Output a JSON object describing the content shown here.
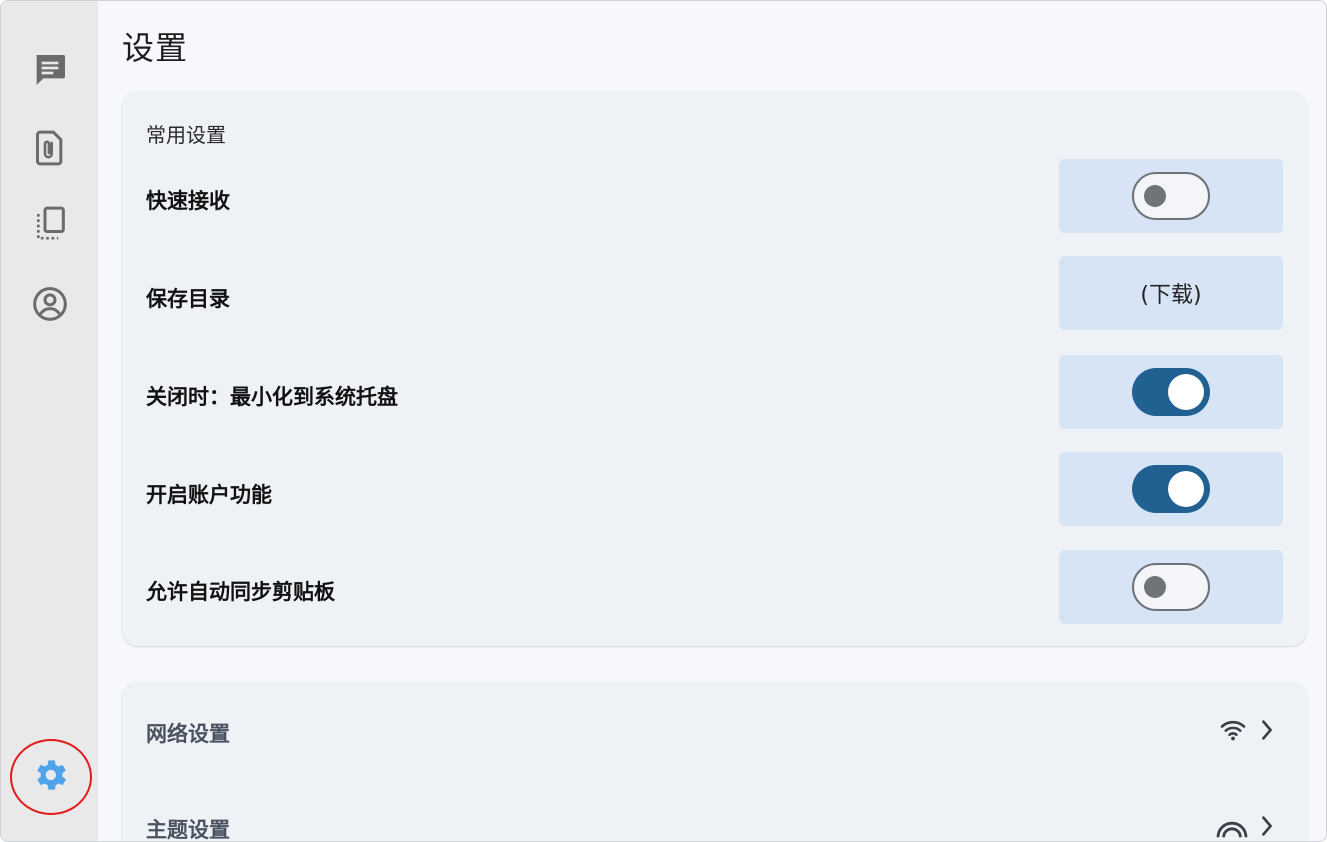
{
  "sidebar": {
    "items": [
      {
        "icon": "message-icon",
        "active": false
      },
      {
        "icon": "file-attachment-icon",
        "active": false
      },
      {
        "icon": "clipboard-history-icon",
        "active": false
      },
      {
        "icon": "account-icon",
        "active": false
      },
      {
        "icon": "settings-gear-icon",
        "active": true
      }
    ]
  },
  "page": {
    "title": "设置"
  },
  "general": {
    "section_title": "常用设置",
    "rows": [
      {
        "label": "快速接收",
        "control": "toggle",
        "on": false
      },
      {
        "label": "保存目录",
        "control": "value",
        "value": "(下载)"
      },
      {
        "label": "关闭时：最小化到系统托盘",
        "control": "toggle",
        "on": true
      },
      {
        "label": "开启账户功能",
        "control": "toggle",
        "on": true
      },
      {
        "label": "允许自动同步剪贴板",
        "control": "toggle",
        "on": false
      }
    ]
  },
  "more": {
    "items": [
      {
        "label": "网络设置",
        "icon": "wifi-icon"
      },
      {
        "label": "主题设置",
        "icon": "theme-icon"
      }
    ]
  },
  "colors": {
    "accent": "#216191",
    "active_icon": "#4fa3e8",
    "control_bg": "#d6e4f5",
    "annotation": "#e21b1b"
  }
}
